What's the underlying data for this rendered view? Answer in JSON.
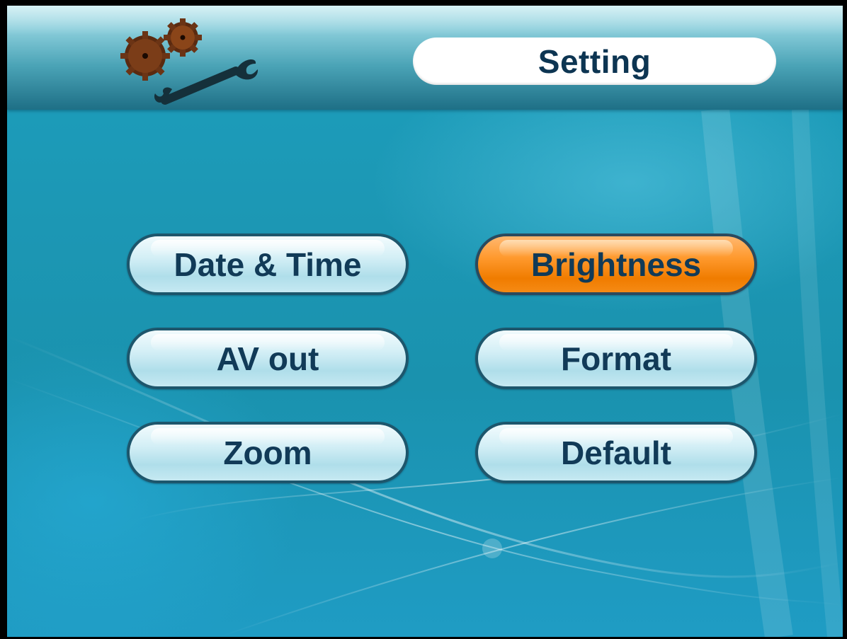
{
  "header": {
    "title": "Setting",
    "logo_icon": "gears-wrench-icon"
  },
  "menu": {
    "selected": "brightness",
    "items": [
      {
        "id": "date-time",
        "label": "Date & Time"
      },
      {
        "id": "brightness",
        "label": "Brightness"
      },
      {
        "id": "av-out",
        "label": "AV out"
      },
      {
        "id": "format",
        "label": "Format"
      },
      {
        "id": "zoom",
        "label": "Zoom"
      },
      {
        "id": "default",
        "label": "Default"
      }
    ]
  },
  "colors": {
    "background": "#1c97b4",
    "button": "#c6e9f2",
    "button_selected": "#f58a14",
    "button_border": "#1d566c",
    "text": "#113a57"
  }
}
